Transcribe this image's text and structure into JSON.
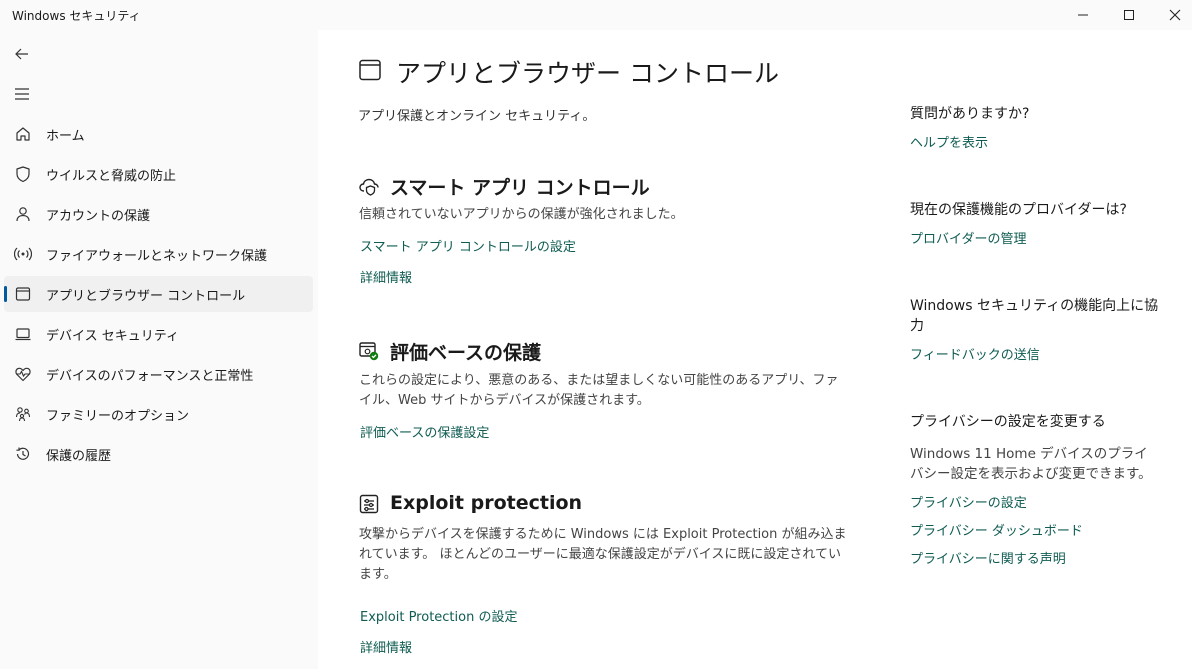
{
  "window": {
    "title": "Windows セキュリティ"
  },
  "sidebar": {
    "items": [
      {
        "label": "ホーム",
        "icon": "home-icon"
      },
      {
        "label": "ウイルスと脅威の防止",
        "icon": "shield-icon"
      },
      {
        "label": "アカウントの保護",
        "icon": "person-icon"
      },
      {
        "label": "ファイアウォールとネットワーク保護",
        "icon": "network-icon"
      },
      {
        "label": "アプリとブラウザー コントロール",
        "icon": "app-window-icon",
        "active": true
      },
      {
        "label": "デバイス セキュリティ",
        "icon": "laptop-icon"
      },
      {
        "label": "デバイスのパフォーマンスと正常性",
        "icon": "heart-pulse-icon"
      },
      {
        "label": "ファミリーのオプション",
        "icon": "family-icon"
      },
      {
        "label": "保護の履歴",
        "icon": "history-icon"
      }
    ]
  },
  "main": {
    "title": "アプリとブラウザー コントロール",
    "subtitle": "アプリ保護とオンライン セキュリティ。",
    "sections": [
      {
        "title": "スマート アプリ コントロール",
        "icon": "cloud-shield-icon",
        "description": "信頼されていないアプリからの保護が強化されました。",
        "links": [
          "スマート アプリ コントロールの設定",
          "詳細情報"
        ]
      },
      {
        "title": "評価ベースの保護",
        "icon": "reputation-check-icon",
        "description": "これらの設定により、悪意のある、または望ましくない可能性のあるアプリ、ファイル、Web サイトからデバイスが保護されます。",
        "links": [
          "評価ベースの保護設定"
        ]
      },
      {
        "title": "Exploit protection",
        "icon": "exploit-sliders-icon",
        "description": "攻撃からデバイスを保護するために Windows には Exploit Protection が組み込まれています。 ほとんどのユーザーに最適な保護設定がデバイスに既に設定されています。",
        "links": [
          "Exploit Protection の設定",
          "詳細情報"
        ]
      }
    ]
  },
  "right": {
    "help_q": "質問がありますか?",
    "help_link": "ヘルプを表示",
    "provider_q": "現在の保護機能のプロバイダーは?",
    "provider_link": "プロバイダーの管理",
    "improve_q": "Windows セキュリティの機能向上に協力",
    "improve_link": "フィードバックの送信",
    "privacy_q": "プライバシーの設定を変更する",
    "privacy_desc": "Windows 11 Home デバイスのプライバシー設定を表示および変更できます。",
    "privacy_links": [
      "プライバシーの設定",
      "プライバシー ダッシュボード",
      "プライバシーに関する声明"
    ]
  },
  "colors": {
    "link": "#0f5c52",
    "accent": "#005a9e",
    "sidebar_bg": "#fafafa",
    "active_bg": "#f0f0f0"
  }
}
